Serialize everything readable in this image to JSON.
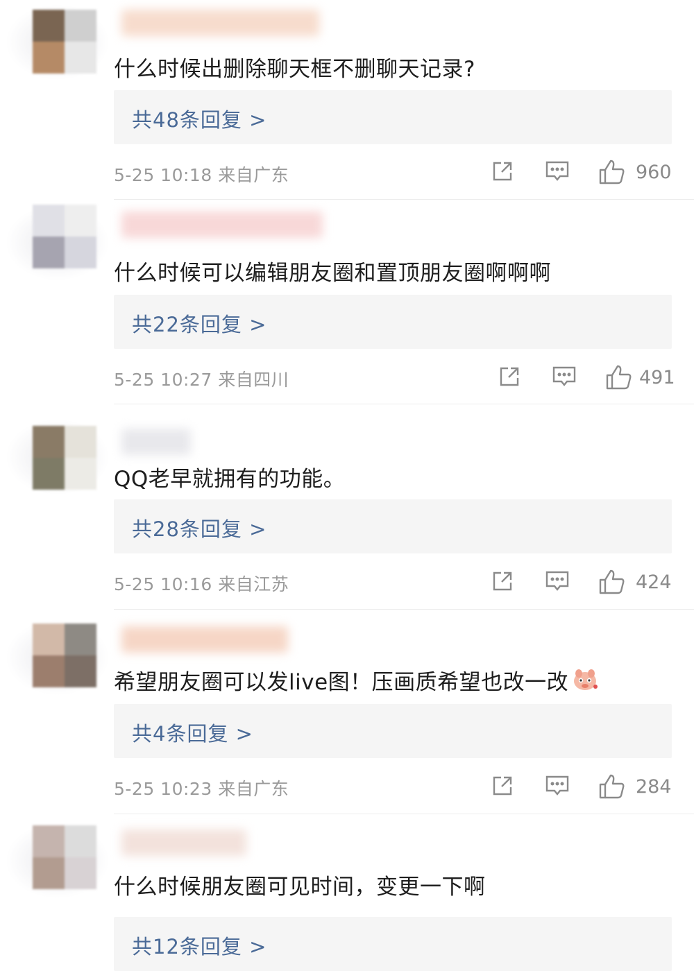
{
  "comments": [
    {
      "text": "什么时候出删除聊天框不删聊天记录?",
      "replies": "共48条回复 >",
      "time": "5-25 10:18",
      "location": "来自广东",
      "likes": "960",
      "avatar_colors": [
        "#7a6552",
        "#cfcfcf",
        "#b58a66",
        "#e7e7e7"
      ],
      "username_color": "#f7dccd"
    },
    {
      "text": "什么时候可以编辑朋友圈和置顶朋友圈啊啊啊",
      "replies": "共22条回复 >",
      "time": "5-25 10:27",
      "location": "来自四川",
      "likes": "491",
      "avatar_colors": [
        "#e0e0e6",
        "#eeeeee",
        "#a6a4b0",
        "#d6d6de"
      ],
      "username_color": "#f8d8d8"
    },
    {
      "text": "QQ老早就拥有的功能。",
      "replies": "共28条回复 >",
      "time": "5-25 10:16",
      "location": "来自江苏",
      "likes": "424",
      "avatar_colors": [
        "#8a7b66",
        "#e5e2da",
        "#7e7b66",
        "#ecebe6"
      ],
      "username_color": "#e8e8ec"
    },
    {
      "text": "希望朋友圈可以发live图！压画质希望也改一改",
      "replies": "共4条回复 >",
      "time": "5-25 10:23",
      "location": "来自广东",
      "likes": "284",
      "avatar_colors": [
        "#d2b9a8",
        "#8e8a84",
        "#9c7e6d",
        "#7d6f66"
      ],
      "username_color": "#f6d6c6"
    },
    {
      "text": "什么时候朋友圈可见时间，变更一下啊",
      "replies": "共12条回复 >",
      "avatar_colors": [
        "#c5b4ae",
        "#dcdcdc",
        "#b29c90",
        "#d8d2d4"
      ],
      "username_color": "#f3e2dc"
    }
  ],
  "icons": [
    "share-icon",
    "comment-icon",
    "like-icon"
  ],
  "colors": {
    "reply_link": "#4a6a97",
    "meta": "#9a9a9a",
    "reply_bg": "#f5f5f5"
  }
}
